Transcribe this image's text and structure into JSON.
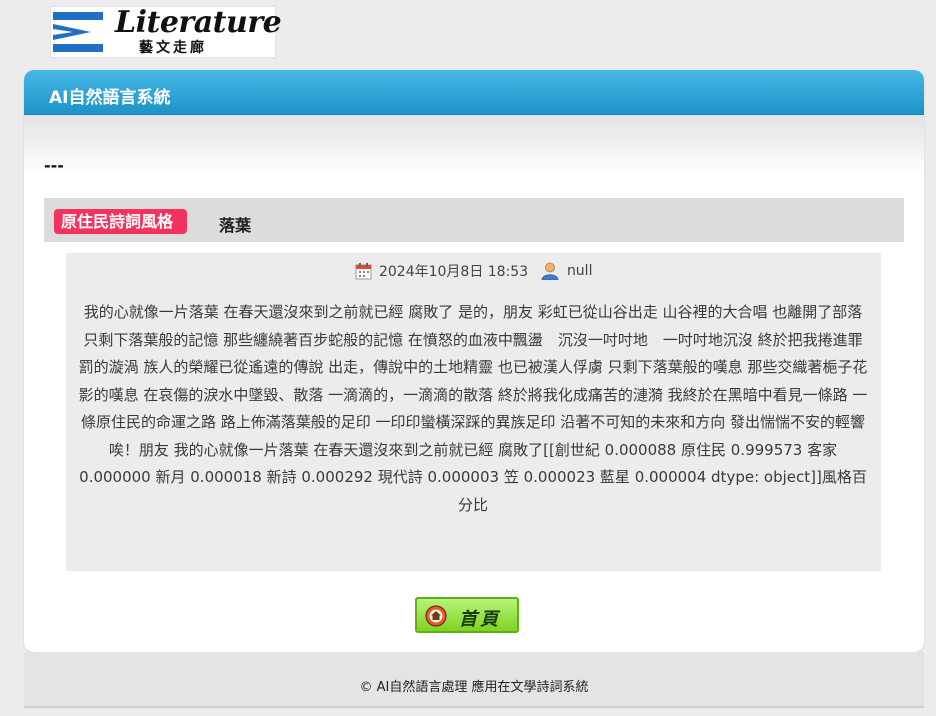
{
  "logo": {
    "brand": "Literature",
    "subtitle": "藝文走廊",
    "icon": "logo-mark-icon"
  },
  "panel": {
    "title": "AI自然語言系統"
  },
  "separator": "---",
  "post": {
    "category": "原住民詩詞風格",
    "title": "落葉",
    "date": "2024年10月8日 18:53",
    "author": "null",
    "body": "我的心就像一片落葉 在春天還沒來到之前就已經 腐敗了 是的，朋友 彩虹已從山谷出走 山谷裡的大合唱 也離開了部落 只剩下落葉般的記憶 那些纏繞著百步蛇般的記憶 在憤怒的血液中飄盪　沉沒一吋吋地　一吋吋地沉沒 終於把我捲進罪罰的漩渦 族人的榮耀已從遙遠的傳說 出走，傳說中的土地精靈 也已被漢人俘虜 只剩下落葉般的嘆息 那些交織著梔子花影的嘆息 在哀傷的淚水中墜毀、散落 一滴滴的，一滴滴的散落 終於將我化成痛苦的漣漪 我終於在黑暗中看見一條路 一條原住民的命運之路 路上佈滿落葉般的足印 一印印蠻橫深踩的異族足印 沿著不可知的未來和方向 發出惴惴不安的輕響 唉！朋友 我的心就像一片落葉 在春天還沒來到之前就已經 腐敗了[[創世紀 0.000088 原住民 0.999573 客家 0.000000 新月 0.000018 新詩 0.000292 現代詩 0.000003 笠 0.000023 藍星 0.000004 dtype: object]]風格百分比"
  },
  "home_button": {
    "label": "首頁",
    "icon": "home-icon"
  },
  "footer": {
    "text": "© AI自然語言處理 應用在文學詩詞系統"
  },
  "colors": {
    "header_blue": "#2aa3d6",
    "badge_pink": "#f5325f",
    "button_green": "#8ad92f"
  }
}
